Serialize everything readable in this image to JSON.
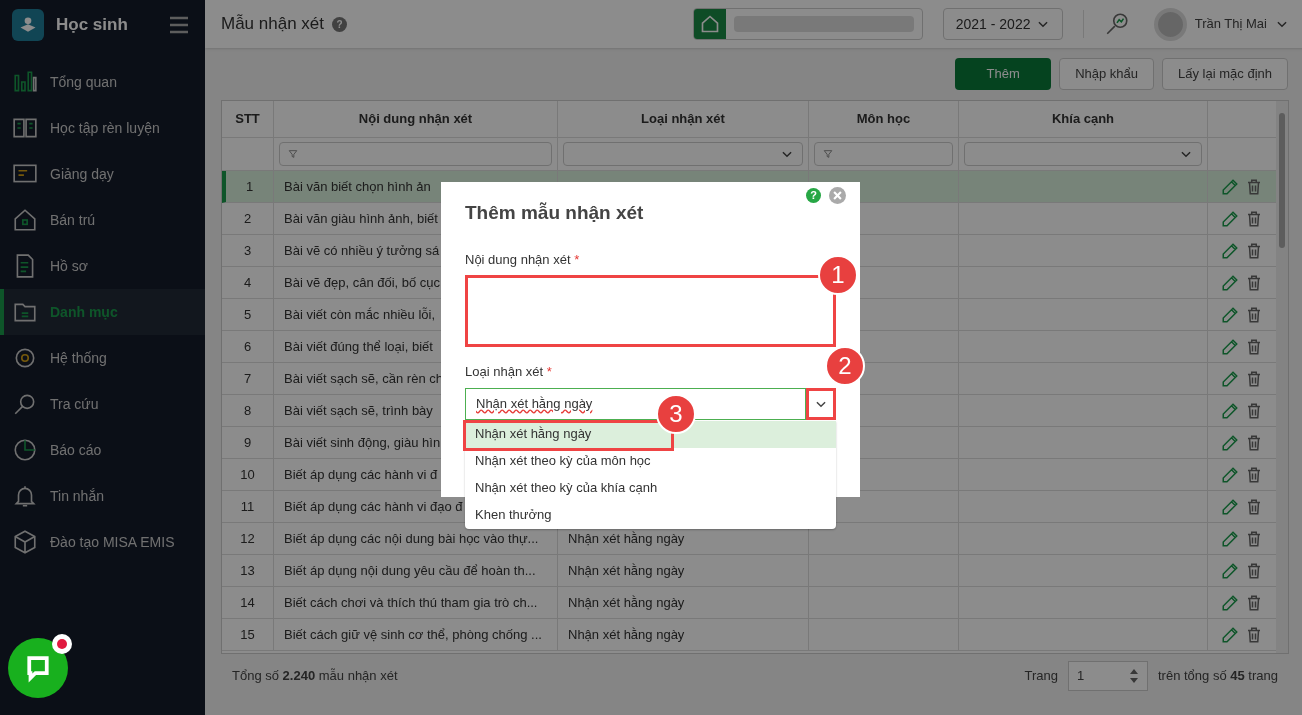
{
  "app": {
    "name": "Học sinh"
  },
  "sidebar": {
    "items": [
      {
        "label": "Tổng quan",
        "selected": false
      },
      {
        "label": "Học tập rèn luyện",
        "selected": false
      },
      {
        "label": "Giảng dạy",
        "selected": false
      },
      {
        "label": "Bán trú",
        "selected": false
      },
      {
        "label": "Hồ sơ",
        "selected": false
      },
      {
        "label": "Danh mục",
        "selected": true
      },
      {
        "label": "Hệ thống",
        "selected": false
      },
      {
        "label": "Tra cứu",
        "selected": false
      },
      {
        "label": "Báo cáo",
        "selected": false
      },
      {
        "label": "Tin nhắn",
        "selected": false
      },
      {
        "label": "Đào tạo MISA EMIS",
        "selected": false
      }
    ]
  },
  "header": {
    "title": "Mẫu nhận xét",
    "help": "?",
    "school_year": "2021 - 2022",
    "user": "Trần Thị Mai"
  },
  "toolbar": {
    "buttons": [
      "Thêm",
      "Nhập khẩu",
      "Lấy lại mặc định"
    ]
  },
  "table": {
    "columns": [
      "STT",
      "Nội dung nhận xét",
      "Loại nhận xét",
      "Môn học",
      "Khía cạnh"
    ],
    "filters": [
      {
        "kind": "none"
      },
      {
        "kind": "text"
      },
      {
        "kind": "select"
      },
      {
        "kind": "text"
      },
      {
        "kind": "select"
      }
    ],
    "rows": [
      {
        "stt": "1",
        "content": "Bài văn biết chọn hình ản",
        "type": "",
        "selected": true
      },
      {
        "stt": "2",
        "content": "Bài văn giàu hình ảnh, biết",
        "type": "",
        "selected": false
      },
      {
        "stt": "3",
        "content": "Bài vẽ có nhiều ý tưởng sá",
        "type": "",
        "selected": false
      },
      {
        "stt": "4",
        "content": "Bài vẽ đẹp, cân đối, bố cục",
        "type": "",
        "selected": false
      },
      {
        "stt": "5",
        "content": "Bài viết còn mắc nhiều lỗi,",
        "type": "",
        "selected": false
      },
      {
        "stt": "6",
        "content": "Bài viết đúng thể loại, biết",
        "type": "",
        "selected": false
      },
      {
        "stt": "7",
        "content": "Bài viết sạch sẽ, cần rèn ch",
        "type": "",
        "selected": false
      },
      {
        "stt": "8",
        "content": "Bài viết sạch sẽ, trình bày",
        "type": "",
        "selected": false
      },
      {
        "stt": "9",
        "content": "Bài viết sinh động, giàu hìn",
        "type": "",
        "selected": false
      },
      {
        "stt": "10",
        "content": "Biết áp dụng các hành vi đ",
        "type": "",
        "selected": false
      },
      {
        "stt": "11",
        "content": "Biết áp dụng các hành vi đạo đ",
        "type": "",
        "selected": false
      },
      {
        "stt": "12",
        "content": "Biết áp dụng các nội dung bài học vào thự...",
        "type": "Nhận xét hằng ngày",
        "selected": false
      },
      {
        "stt": "13",
        "content": "Biết áp dụng nội dung yêu cầu để hoàn th...",
        "type": "Nhận xét hằng ngày",
        "selected": false
      },
      {
        "stt": "14",
        "content": "Biết cách chơi và thích thú tham gia trò ch...",
        "type": "Nhận xét hằng ngày",
        "selected": false
      },
      {
        "stt": "15",
        "content": "Biết cách giữ vệ sinh cơ thể, phòng chống ...",
        "type": "Nhận xét hằng ngày",
        "selected": false
      }
    ]
  },
  "footer": {
    "total": "Tổng số **2.240** mẫu nhận xét",
    "page_label": "Trang",
    "page": "1",
    "pages": "trên tổng số **45** trang"
  },
  "modal": {
    "title": "Thêm mẫu nhận xét",
    "help": "?",
    "fields": [
      {
        "kind": "textarea",
        "label": "Nội dung nhận xét",
        "required_mark": "*",
        "annotation": "1"
      },
      {
        "kind": "select",
        "label": "Loại nhận xét",
        "required_mark": "*",
        "value": "Nhận xét hằng ngày",
        "annotation": "2"
      }
    ],
    "options": [
      {
        "label": "Nhận xét hằng ngày",
        "selected": true,
        "annotation": "3"
      },
      {
        "label": "Nhận xét theo kỳ của môn học",
        "selected": false
      },
      {
        "label": "Nhận xét theo kỳ của khía cạnh",
        "selected": false
      },
      {
        "label": "Khen thưởng",
        "selected": false
      }
    ]
  }
}
